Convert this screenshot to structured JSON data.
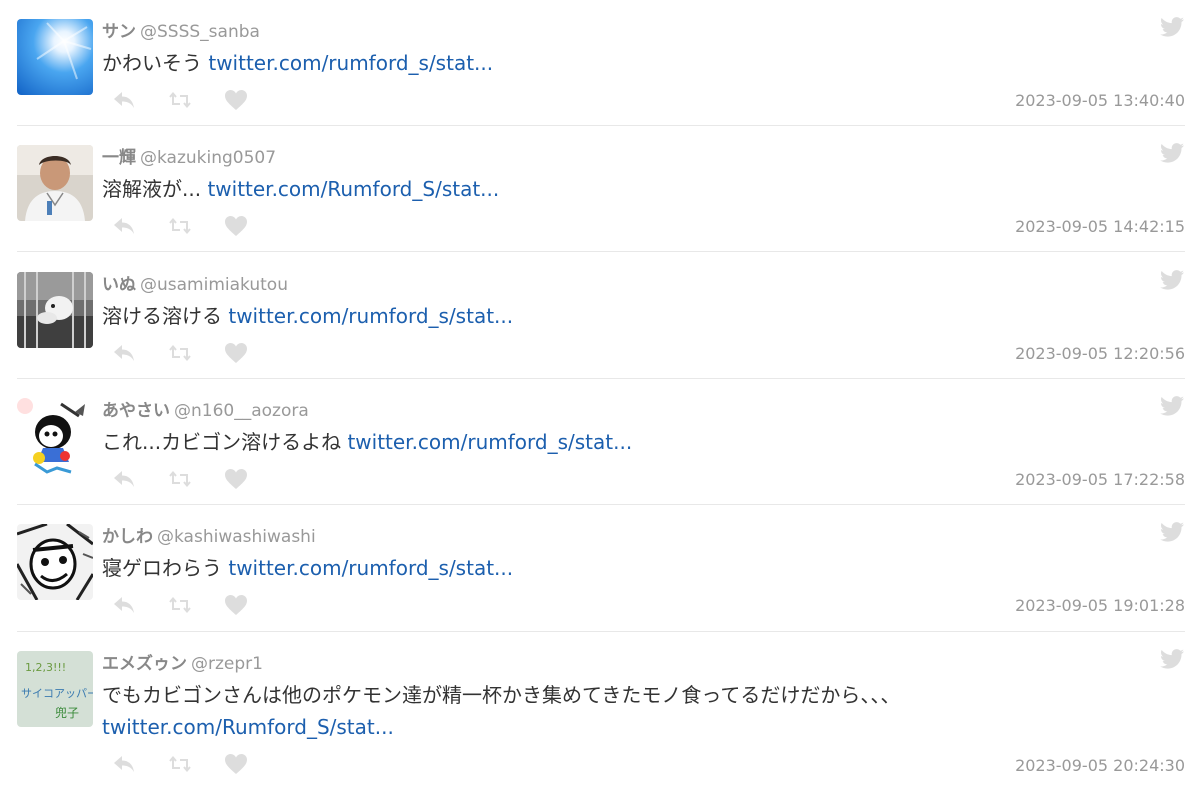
{
  "tweets": [
    {
      "name": "サン",
      "handle": "@SSSS_sanba",
      "text": "かわいそう",
      "link": "twitter.com/rumford_s/stat...",
      "time": "2023-09-05 13:40:40"
    },
    {
      "name": "一輝",
      "handle": "@kazuking0507",
      "text": "溶解液が...",
      "link": "twitter.com/Rumford_S/stat...",
      "time": "2023-09-05 14:42:15"
    },
    {
      "name": "いぬ",
      "handle": "@usamimiakutou",
      "text": "溶ける溶ける",
      "link": "twitter.com/rumford_s/stat...",
      "time": "2023-09-05 12:20:56"
    },
    {
      "name": "あやさい",
      "handle": "@n160__aozora",
      "text": "これ...カビゴン溶けるよね",
      "link": "twitter.com/rumford_s/stat...",
      "time": "2023-09-05 17:22:58"
    },
    {
      "name": "かしわ",
      "handle": "@kashiwashiwashi",
      "text": "寝ゲロわらう",
      "link": "twitter.com/rumford_s/stat...",
      "time": "2023-09-05 19:01:28"
    },
    {
      "name": "エメズゥン",
      "handle": "@rzepr1",
      "text": "でもカビゴンさんは他のポケモン達が精一杯かき集めてきたモノ食ってるだけだから、、、",
      "link": "twitter.com/Rumford_S/stat...",
      "time": "2023-09-05 20:24:30"
    }
  ],
  "avatar_texts": {
    "line1": "1,2,3!!!",
    "line2": "サイコアッパー",
    "line3": "兜子"
  },
  "icons": {
    "reply": "reply-icon",
    "retweet": "retweet-icon",
    "like": "heart-icon",
    "platform": "twitter-bird-icon"
  },
  "colors": {
    "link": "#1c5fae",
    "name": "#888888",
    "meta": "#999999",
    "icon": "#dddddd",
    "separator": "#e8e8e8"
  }
}
